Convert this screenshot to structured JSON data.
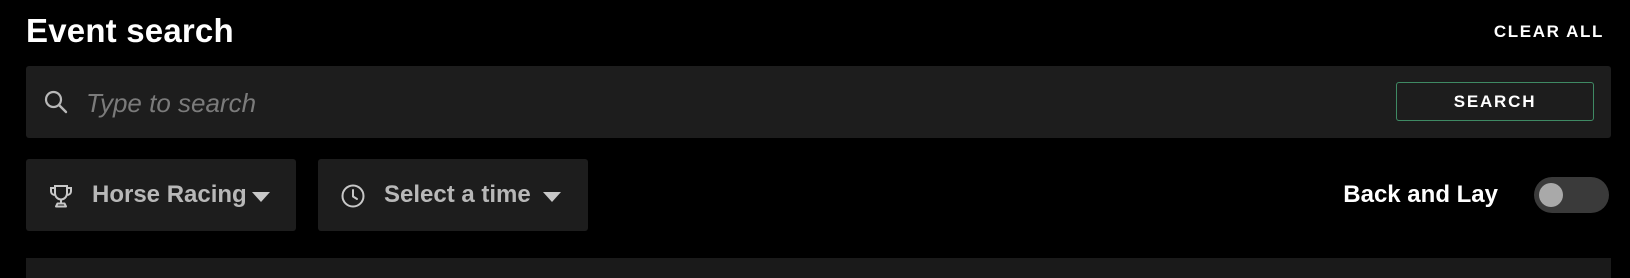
{
  "header": {
    "title": "Event search",
    "clear_all_label": "CLEAR ALL"
  },
  "search": {
    "icon": "search-icon",
    "placeholder": "Type to search",
    "value": "",
    "button_label": "SEARCH"
  },
  "filters": {
    "sport": {
      "icon": "trophy-icon",
      "label": "Horse Racing"
    },
    "time": {
      "icon": "clock-icon",
      "label": "Select a time"
    }
  },
  "back_and_lay": {
    "label": "Back and Lay",
    "enabled": false
  },
  "colors": {
    "background": "#000000",
    "panel": "#1d1d1d",
    "accent_border": "#3f8a64",
    "muted_text": "#b8b8b8",
    "placeholder_text": "#7b7b7b"
  }
}
